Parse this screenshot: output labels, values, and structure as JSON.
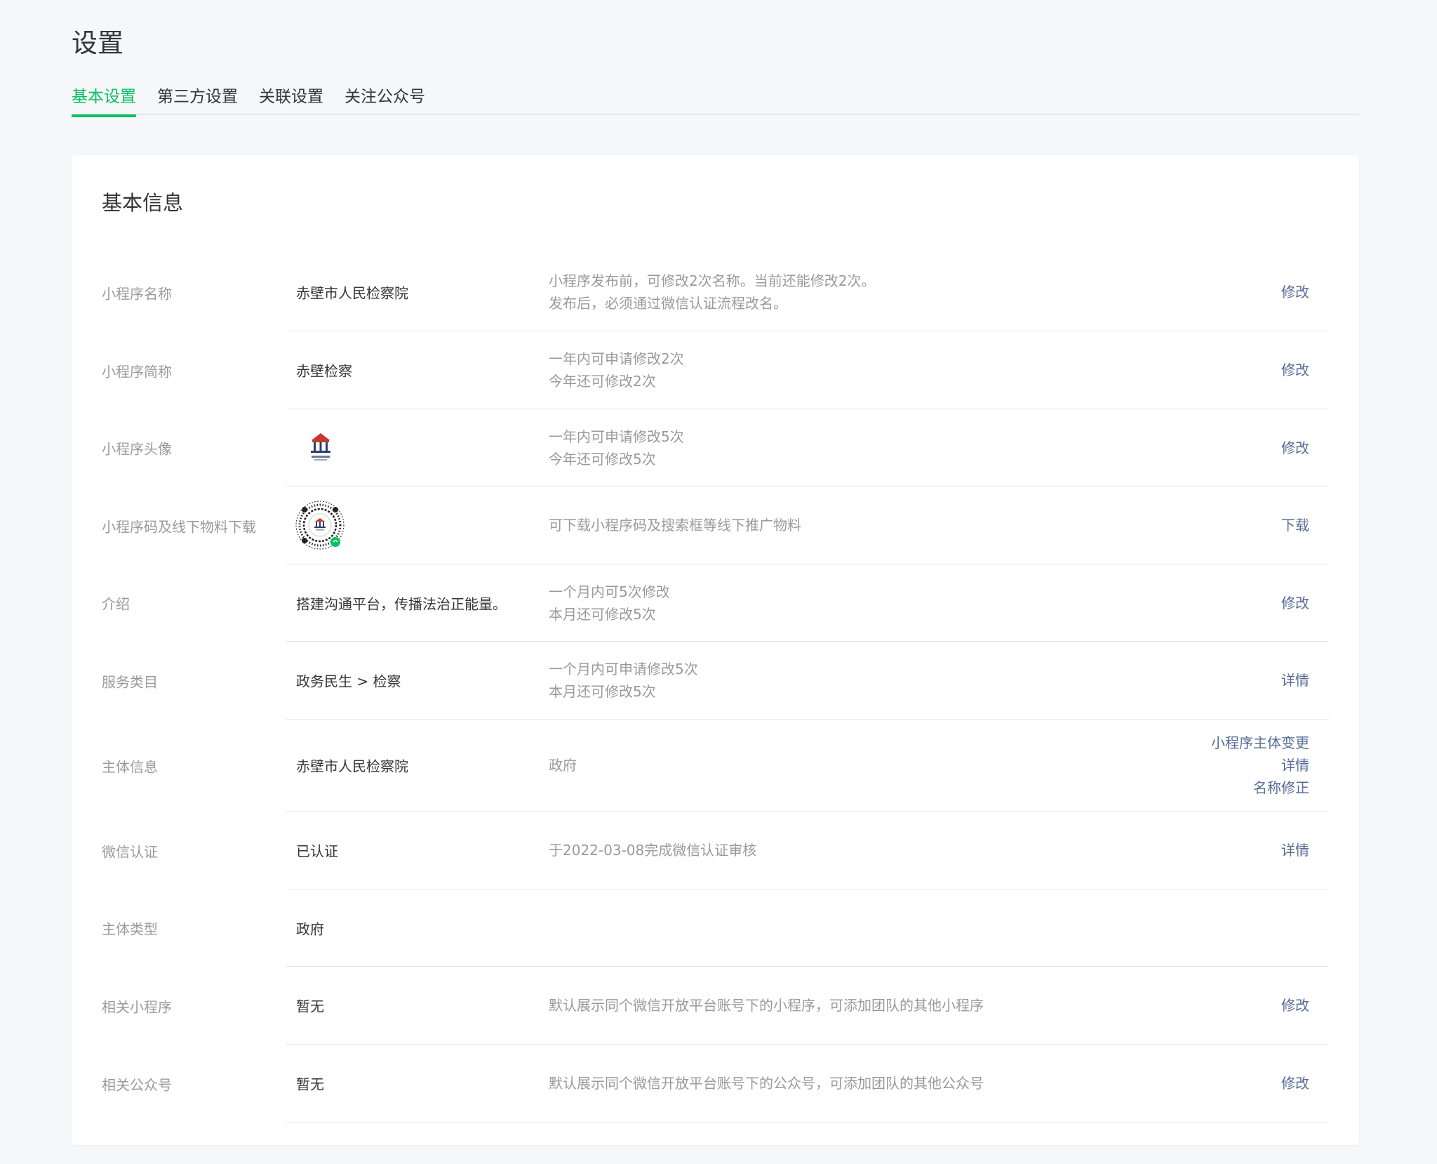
{
  "page": {
    "title": "设置"
  },
  "tabs": [
    {
      "label": "基本设置",
      "active": true
    },
    {
      "label": "第三方设置",
      "active": false
    },
    {
      "label": "关联设置",
      "active": false
    },
    {
      "label": "关注公众号",
      "active": false
    }
  ],
  "card": {
    "title": "基本信息"
  },
  "rows": {
    "name": {
      "label": "小程序名称",
      "value": "赤壁市人民检察院",
      "desc1": "小程序发布前，可修改2次名称。当前还能修改2次。",
      "desc2": "发布后，必须通过微信认证流程改名。",
      "action": "修改"
    },
    "short_name": {
      "label": "小程序简称",
      "value": "赤壁检察",
      "desc1": "一年内可申请修改2次",
      "desc2": "今年还可修改2次",
      "action": "修改"
    },
    "avatar": {
      "label": "小程序头像",
      "desc1": "一年内可申请修改5次",
      "desc2": "今年还可修改5次",
      "action": "修改"
    },
    "qrcode": {
      "label": "小程序码及线下物料下载",
      "desc1": "可下载小程序码及搜索框等线下推广物料",
      "action": "下载"
    },
    "intro": {
      "label": "介绍",
      "value": "搭建沟通平台，传播法治正能量。",
      "desc1": "一个月内可5次修改",
      "desc2": "本月还可修改5次",
      "action": "修改"
    },
    "category": {
      "label": "服务类目",
      "value": "政务民生 > 检察",
      "desc1": "一个月内可申请修改5次",
      "desc2": "本月还可修改5次",
      "action": "详情"
    },
    "subject": {
      "label": "主体信息",
      "value": "赤壁市人民检察院",
      "desc1": "政府",
      "action1": "小程序主体变更",
      "action2": "详情",
      "action3": "名称修正"
    },
    "wechat_cert": {
      "label": "微信认证",
      "value": "已认证",
      "desc1": "于2022-03-08完成微信认证审核",
      "action": "详情"
    },
    "subject_type": {
      "label": "主体类型",
      "value": "政府"
    },
    "related_mini": {
      "label": "相关小程序",
      "value": "暂无",
      "desc1": "默认展示同个微信开放平台账号下的小程序，可添加团队的其他小程序",
      "action": "修改"
    },
    "related_oa": {
      "label": "相关公众号",
      "value": "暂无",
      "desc1": "默认展示同个微信开放平台账号下的公众号，可添加团队的其他公众号",
      "action": "修改"
    }
  },
  "colors": {
    "accent": "#07c160",
    "link": "#576b95",
    "muted": "#9a9a9a",
    "text": "#353535"
  }
}
